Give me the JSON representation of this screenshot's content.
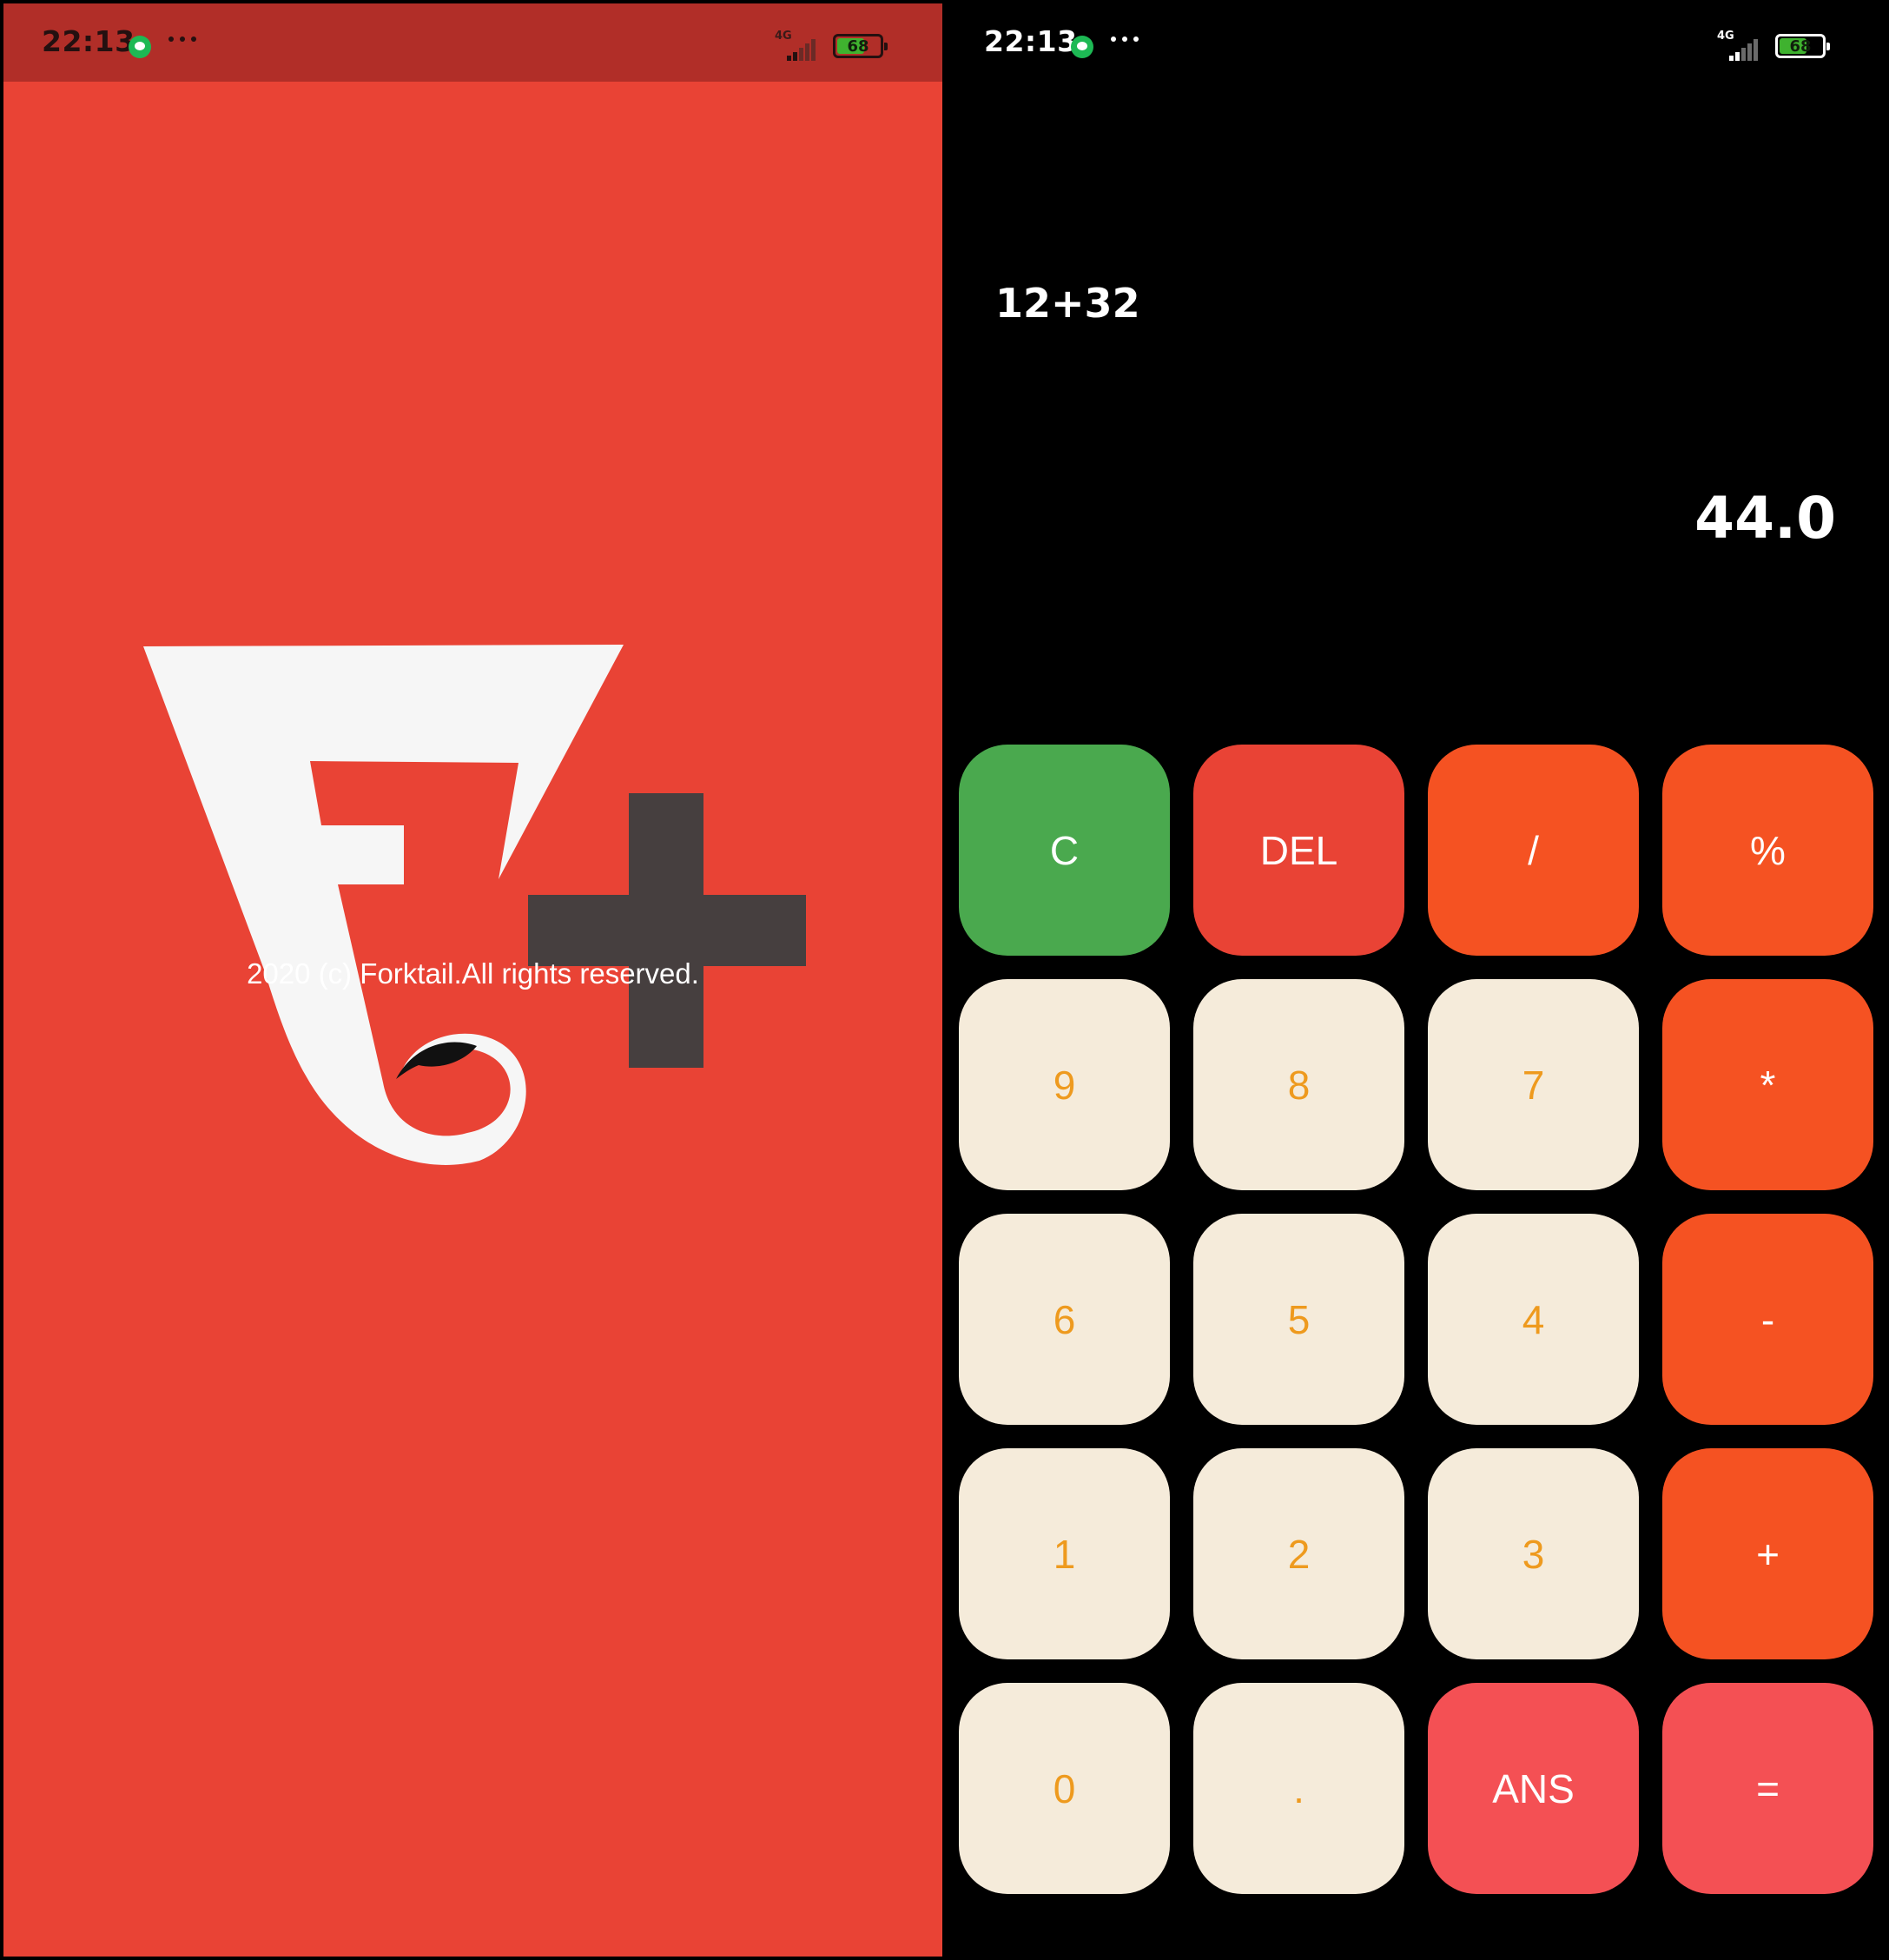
{
  "splash": {
    "status_bar": {
      "time": "22:13",
      "network": "4G",
      "battery": "68",
      "battery_level": 0.68
    },
    "logo": {
      "name": "forktail-plus-logo",
      "colors": {
        "background": "#E94335",
        "mark": "#F6F6F6",
        "plus": "#463F3F",
        "eye": "#111111"
      }
    },
    "copyright": "2020 (c) Forktail.All rights reserved."
  },
  "calculator": {
    "status_bar": {
      "time": "22:13",
      "network": "4G",
      "battery": "68",
      "battery_level": 0.68
    },
    "expression": "12+32",
    "result": "44.0",
    "keys": [
      {
        "label": "C",
        "name": "clear-button",
        "kind": "k-clear"
      },
      {
        "label": "DEL",
        "name": "delete-button",
        "kind": "k-del"
      },
      {
        "label": "/",
        "name": "divide-button",
        "kind": "k-op"
      },
      {
        "label": "%",
        "name": "percent-button",
        "kind": "k-op"
      },
      {
        "label": "9",
        "name": "digit-9-button",
        "kind": "k-num"
      },
      {
        "label": "8",
        "name": "digit-8-button",
        "kind": "k-num"
      },
      {
        "label": "7",
        "name": "digit-7-button",
        "kind": "k-num"
      },
      {
        "label": "*",
        "name": "multiply-button",
        "kind": "k-op"
      },
      {
        "label": "6",
        "name": "digit-6-button",
        "kind": "k-num"
      },
      {
        "label": "5",
        "name": "digit-5-button",
        "kind": "k-num"
      },
      {
        "label": "4",
        "name": "digit-4-button",
        "kind": "k-num"
      },
      {
        "label": "-",
        "name": "subtract-button",
        "kind": "k-op"
      },
      {
        "label": "1",
        "name": "digit-1-button",
        "kind": "k-num"
      },
      {
        "label": "2",
        "name": "digit-2-button",
        "kind": "k-num"
      },
      {
        "label": "3",
        "name": "digit-3-button",
        "kind": "k-num"
      },
      {
        "label": "+",
        "name": "add-button",
        "kind": "k-op"
      },
      {
        "label": "0",
        "name": "digit-0-button",
        "kind": "k-num"
      },
      {
        "label": ".",
        "name": "decimal-point-button",
        "kind": "k-num"
      },
      {
        "label": "ANS",
        "name": "answer-button",
        "kind": "k-ans"
      },
      {
        "label": "=",
        "name": "equals-button",
        "kind": "k-ans"
      }
    ],
    "colors": {
      "clear": "#4AA94E",
      "delete": "#E94335",
      "operator": "#F55222",
      "digit_bg": "#F5EBDA",
      "digit_text": "#EE9A1E",
      "answer": "#F45054"
    }
  }
}
